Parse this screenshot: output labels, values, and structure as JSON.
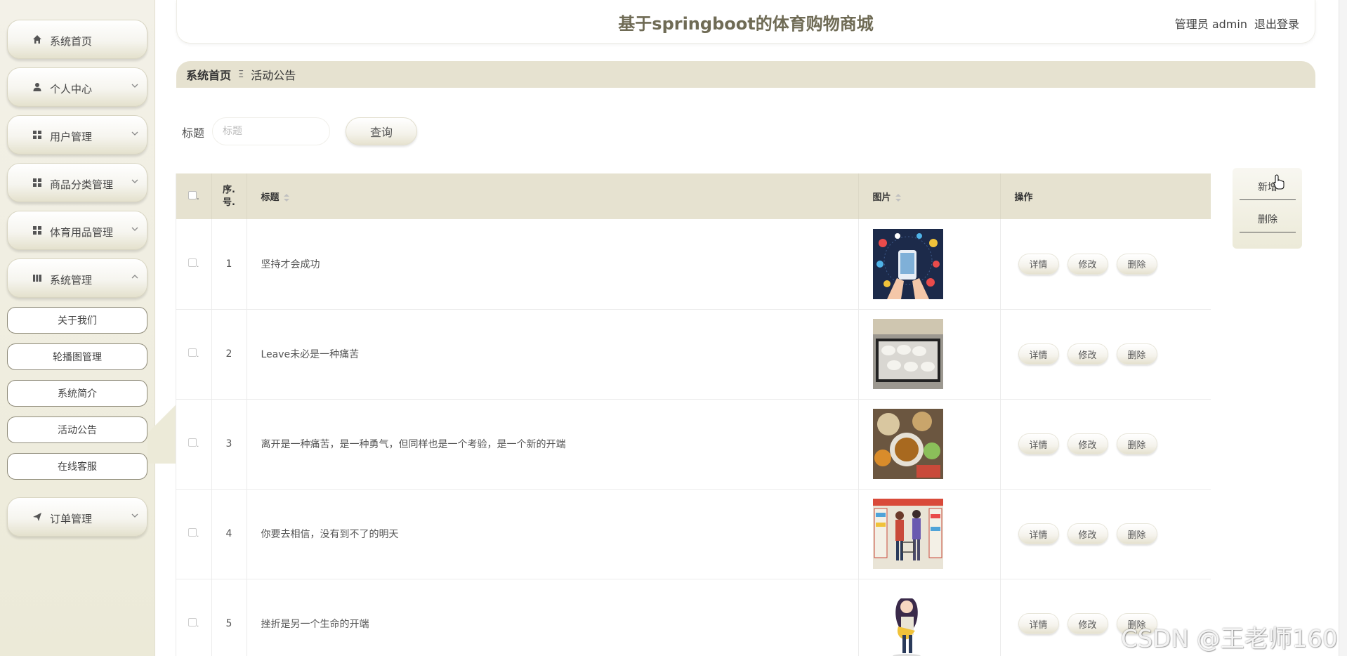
{
  "header": {
    "title": "基于springboot的体育购物商城",
    "user_label": "管理员 admin",
    "logout_label": "退出登录"
  },
  "sidebar": {
    "items": [
      {
        "label": "系统首页",
        "icon": "home-icon"
      },
      {
        "label": "个人中心",
        "icon": "user-icon"
      },
      {
        "label": "用户管理",
        "icon": "grid-icon"
      },
      {
        "label": "商品分类管理",
        "icon": "grid-icon"
      },
      {
        "label": "体育用品管理",
        "icon": "grid-icon"
      },
      {
        "label": "系统管理",
        "icon": "book-icon"
      },
      {
        "label": "订单管理",
        "icon": "paper-plane-icon"
      }
    ],
    "sub_items": [
      {
        "label": "关于我们"
      },
      {
        "label": "轮播图管理"
      },
      {
        "label": "系统简介"
      },
      {
        "label": "活动公告"
      },
      {
        "label": "在线客服"
      }
    ]
  },
  "breadcrumb": {
    "home": "系统首页",
    "separator": "Ξ",
    "current": "活动公告"
  },
  "search": {
    "label": "标题",
    "placeholder": "标题",
    "button": "查询"
  },
  "table": {
    "columns": [
      "序.号.",
      "标题",
      "图片",
      "操作"
    ],
    "rows": [
      {
        "index": "1",
        "title": "坚持才会成功",
        "image": "phone-shopping-illustration"
      },
      {
        "index": "2",
        "title": "Leave未必是一种痛苦",
        "image": "dumplings-tray-photo"
      },
      {
        "index": "3",
        "title": "离开是一种痛苦，是一种勇气，但同样也是一个考验，是一个新的开端",
        "image": "food-table-photo"
      },
      {
        "index": "4",
        "title": "你要去相信，没有到不了的明天",
        "image": "couple-shopping-illustration"
      },
      {
        "index": "5",
        "title": "挫折是另一个生命的开端",
        "image": "girl-shopping-bag-illustration"
      }
    ],
    "ops": {
      "detail": "详情",
      "edit": "修改",
      "delete": "删除"
    }
  },
  "side_actions": {
    "add": "新增",
    "delete": "删除"
  },
  "watermark": "CSDN @王老师160",
  "colors": {
    "accent": "#e6e2d0",
    "title": "#6f6b55",
    "sidebar_bg": "#f3f1e8"
  }
}
